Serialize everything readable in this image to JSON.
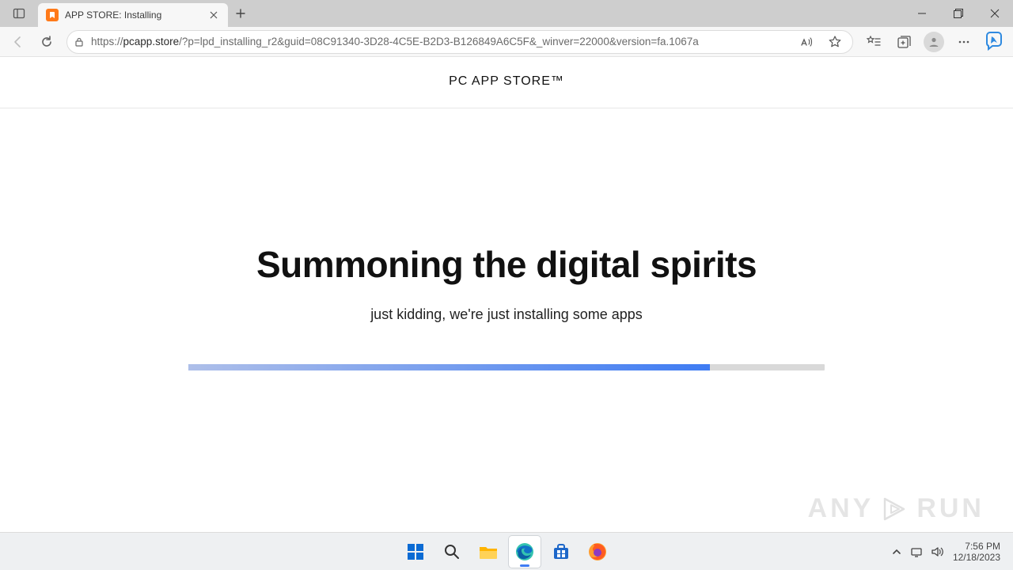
{
  "browser": {
    "tab": {
      "title": "APP STORE: Installing"
    },
    "url": {
      "scheme": "https://",
      "host": "pcapp.store",
      "rest": "/?p=lpd_installing_r2&guid=08C91340-3D28-4C5E-B2D3-B126849A6C5F&_winver=22000&version=fa.1067a"
    }
  },
  "page": {
    "brand": "PC APP STORE™",
    "headline": "Summoning the digital spirits",
    "subline": "just kidding, we're just installing some apps",
    "progress_pct": "82%"
  },
  "watermark": {
    "left": "ANY",
    "right": "RUN"
  },
  "tray": {
    "time": "7:56 PM",
    "date": "12/18/2023"
  }
}
